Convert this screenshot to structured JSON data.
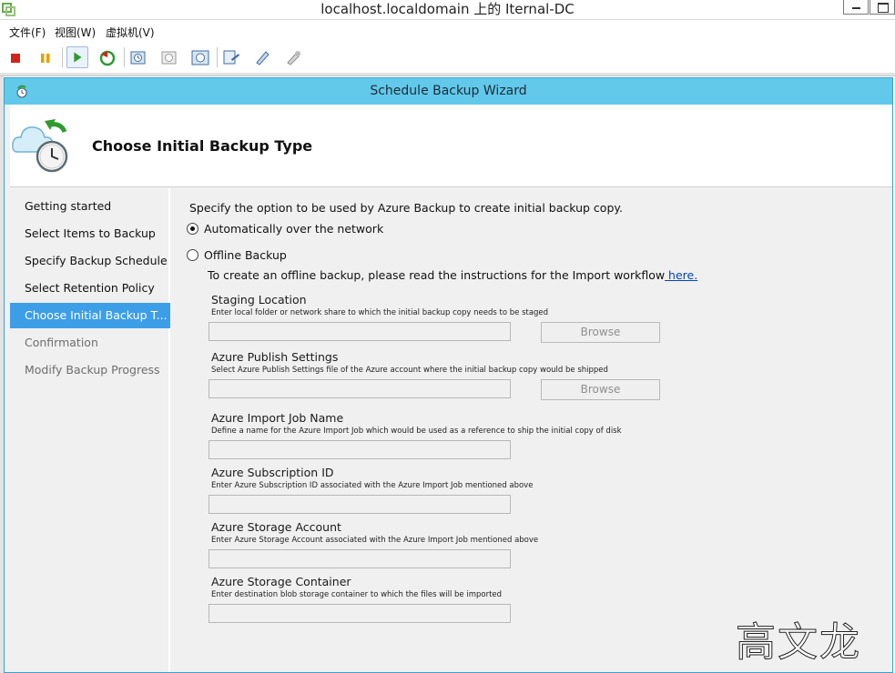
{
  "vm_window": {
    "title": "localhost.localdomain 上的 Iternal-DC",
    "menu": [
      {
        "label": "文件(F)"
      },
      {
        "label": "视图(W)"
      },
      {
        "label": "虚拟机(V)"
      }
    ],
    "toolbar_icons": [
      "stop-icon",
      "pause-icon",
      "play-icon",
      "reset-icon",
      "snapshot-take-icon",
      "snapshot-revert-icon",
      "snapshot-manager-icon",
      "vm-settings-icon",
      "vm-tools-icon",
      "vm-options-icon"
    ]
  },
  "wizard": {
    "title": "Schedule Backup Wizard",
    "page_title": "Choose Initial Backup Type",
    "nav": [
      {
        "label": "Getting started",
        "state": "normal"
      },
      {
        "label": "Select Items to Backup",
        "state": "normal"
      },
      {
        "label": "Specify Backup Schedule",
        "state": "normal"
      },
      {
        "label": "Select Retention Policy",
        "state": "normal"
      },
      {
        "label": "Choose Initial Backup Type",
        "state": "active"
      },
      {
        "label": "Confirmation",
        "state": "disabled"
      },
      {
        "label": "Modify Backup Progress",
        "state": "disabled"
      }
    ],
    "instruction": "Specify the option to be used by Azure Backup to create initial backup copy.",
    "options": {
      "network": {
        "label": "Automatically over the network",
        "selected": true
      },
      "offline": {
        "label": "Offline Backup",
        "selected": false
      }
    },
    "offline_note": "To create an offline backup, please read the instructions for the Import workflow",
    "offline_link": " here.",
    "fields": [
      {
        "label": "Staging Location",
        "help": "Enter local folder or network share to which the initial backup copy needs to be staged",
        "value": "",
        "has_browse": true
      },
      {
        "label": "Azure Publish Settings",
        "help": "Select Azure Publish Settings file of the Azure account where the initial backup copy would be shipped",
        "value": "",
        "has_browse": true
      },
      {
        "label": "Azure Import Job Name",
        "help": "Define a name for the Azure Import Job which would be used as a reference to ship the initial copy of disk",
        "value": "",
        "has_browse": false
      },
      {
        "label": "Azure Subscription ID",
        "help": "Enter Azure Subscription ID associated with the Azure Import Job mentioned above",
        "value": "",
        "has_browse": false
      },
      {
        "label": "Azure Storage Account",
        "help": "Enter Azure Storage Account associated with the Azure Import Job mentioned above",
        "value": "",
        "has_browse": false
      },
      {
        "label": "Azure Storage Container",
        "help": "Enter destination blob storage container to which the files will be imported",
        "value": "",
        "has_browse": false
      }
    ],
    "browse_label": "Browse"
  },
  "watermark": "高文龙",
  "colors": {
    "wizard_titlebar": "#62c9ea",
    "nav_active": "#3d9ee8",
    "link": "#0645ad"
  }
}
